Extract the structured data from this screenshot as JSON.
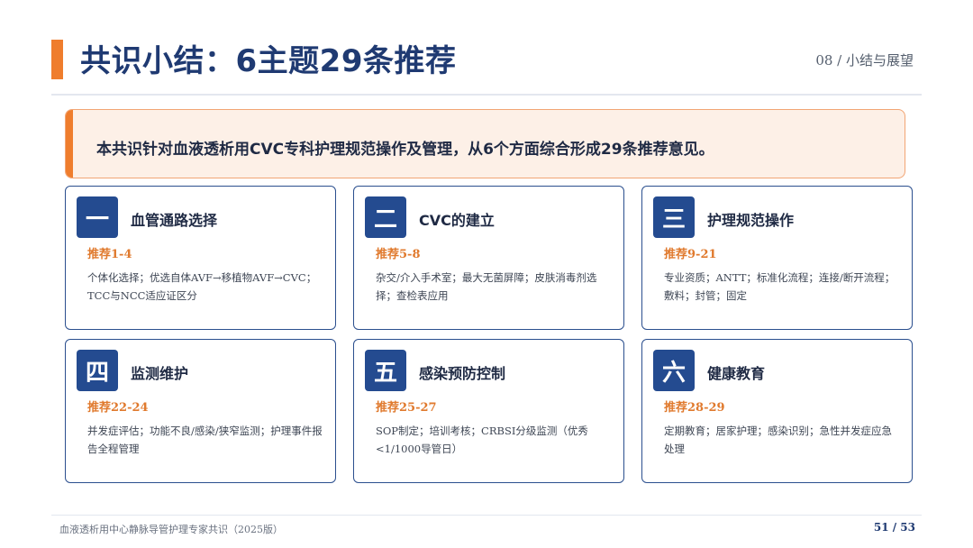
{
  "header": {
    "title": "共识小结：6主题29条推荐",
    "section": "08  /  小结与展望"
  },
  "callout": {
    "text": "本共识针对血液透析用CVC专科护理规范操作及管理，从6个方面综合形成29条推荐意见。"
  },
  "cards": [
    {
      "num": "一",
      "title": "血管通路选择",
      "rec": "推荐1-4",
      "desc": "个体化选择；优选自体AVF→移植物AVF→CVC；TCC与NCC适应证区分"
    },
    {
      "num": "二",
      "title": "CVC的建立",
      "rec": "推荐5-8",
      "desc": "杂交/介入手术室；最大无菌屏障；皮肤消毒剂选择；查检表应用"
    },
    {
      "num": "三",
      "title": "护理规范操作",
      "rec": "推荐9-21",
      "desc": "专业资质；ANTT；标准化流程；连接/断开流程；敷料；封管；固定"
    },
    {
      "num": "四",
      "title": "监测维护",
      "rec": "推荐22-24",
      "desc": "并发症评估；功能不良/感染/狭窄监测；护理事件报告全程管理"
    },
    {
      "num": "五",
      "title": "感染预防控制",
      "rec": "推荐25-27",
      "desc": "SOP制定；培训考核；CRBSI分级监测（优秀<1/1000导管日）"
    },
    {
      "num": "六",
      "title": "健康教育",
      "rec": "推荐28-29",
      "desc": "定期教育；居家护理；感染识别；急性并发症应急处理"
    }
  ],
  "footer": {
    "source": "血液透析用中心静脉导管护理专家共识（2025版）",
    "page": "51 / 53"
  },
  "colors": {
    "accent_orange": "#ef7d2d",
    "primary_navy": "#244b90",
    "title_navy": "#1f3a72",
    "callout_bg": "#fdf0e7"
  }
}
